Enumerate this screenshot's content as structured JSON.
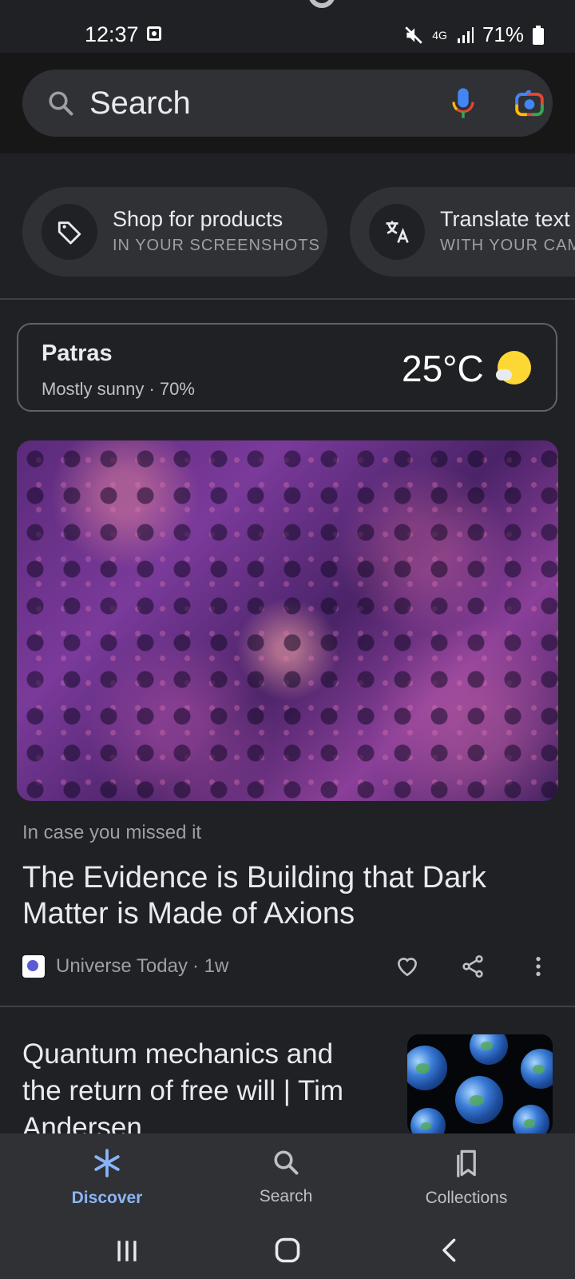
{
  "status_bar": {
    "time": "12:37",
    "network": "4G",
    "battery": "71%"
  },
  "search": {
    "placeholder": "Search"
  },
  "chips": [
    {
      "title": "Shop for products",
      "subtitle": "IN YOUR SCREENSHOTS",
      "icon": "tag-icon"
    },
    {
      "title": "Translate text",
      "subtitle": "WITH YOUR CAM",
      "icon": "translate-icon"
    }
  ],
  "weather": {
    "city": "Patras",
    "condition": "Mostly sunny · 70%",
    "temperature": "25°C",
    "icon": "sunny-icon"
  },
  "article1": {
    "kicker": "In case you missed it",
    "headline": "The Evidence is Building that Dark Matter is Made of Axions",
    "source": "Universe Today",
    "age": "· 1w"
  },
  "article2": {
    "headline": "Quantum mechanics and the return of free will | Tim Andersen"
  },
  "bottom_nav": [
    {
      "label": "Discover",
      "active": true
    },
    {
      "label": "Search",
      "active": false
    },
    {
      "label": "Collections",
      "active": false
    }
  ],
  "colors": {
    "accent": "#8ab4f8",
    "background": "#202124",
    "surface": "#303134"
  }
}
